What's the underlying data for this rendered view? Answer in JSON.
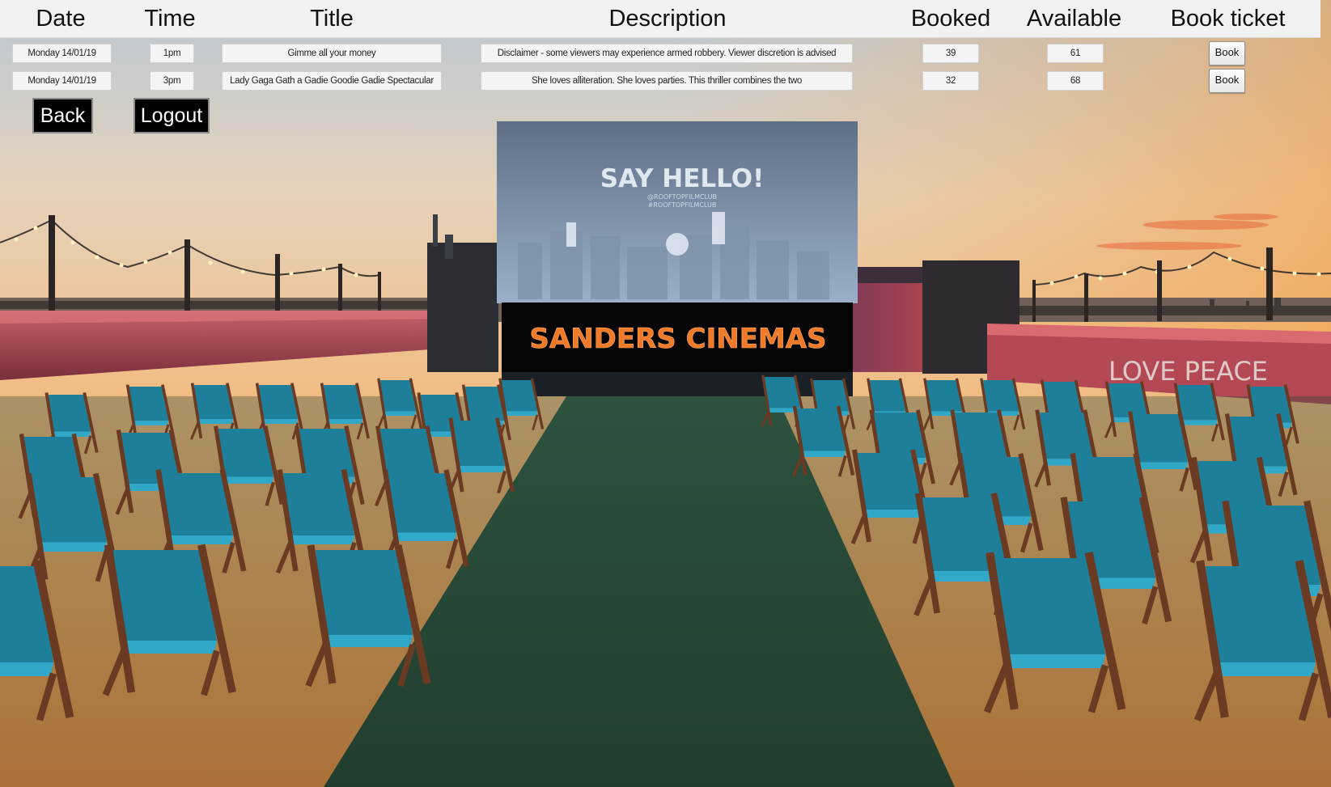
{
  "headers": {
    "date": "Date",
    "time": "Time",
    "title": "Title",
    "description": "Description",
    "booked": "Booked",
    "available": "Available",
    "book_ticket": "Book ticket"
  },
  "rows": [
    {
      "date": "Monday 14/01/19",
      "time": "1pm",
      "title": "Gimme all your money",
      "description": "Disclaimer - some viewers may experience armed robbery. Viewer discretion is advised",
      "booked": "39",
      "available": "61",
      "book_label": "Book"
    },
    {
      "date": "Monday 14/01/19",
      "time": "3pm",
      "title": "Lady Gaga Gath a Gadie Goodie Gadie Spectacular",
      "description": "She loves alliteration. She loves parties. This thriller combines the two",
      "booked": "32",
      "available": "68",
      "book_label": "Book"
    }
  ],
  "nav": {
    "back_label": "Back",
    "logout_label": "Logout"
  },
  "scene": {
    "screen_title": "SAY HELLO!",
    "screen_handles": "@ROOFTOPFILMCLUB",
    "screen_handles_2": "#ROOFTOPFILMCLUB",
    "banner": "SANDERS CINEMAS",
    "wall_text": "LOVE PEACE"
  },
  "colors": {
    "banner_text": "#f07a2a",
    "chair_fabric": "#1d7f9a",
    "turf": "#2c4a38"
  }
}
